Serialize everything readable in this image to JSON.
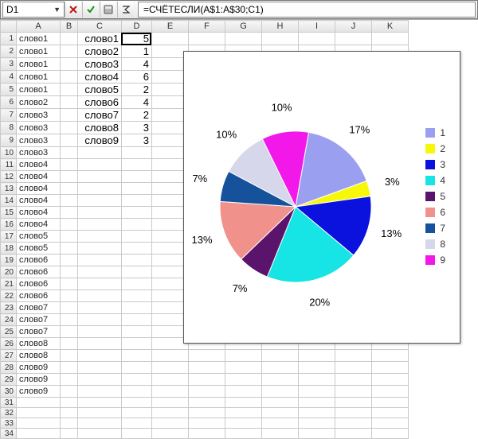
{
  "formula_bar": {
    "cell_ref": "D1",
    "formula": "=СЧЁТЕСЛИ(A$1:A$30;C1)"
  },
  "columns": [
    "A",
    "B",
    "C",
    "D",
    "E",
    "F",
    "G",
    "H",
    "I",
    "J",
    "K"
  ],
  "rows": [
    "1",
    "2",
    "3",
    "4",
    "5",
    "6",
    "7",
    "8",
    "9",
    "10",
    "11",
    "12",
    "13",
    "14",
    "15",
    "16",
    "17",
    "18",
    "19",
    "20",
    "21",
    "22",
    "23",
    "24",
    "25",
    "26",
    "27",
    "28",
    "29",
    "30",
    "31",
    "32",
    "33",
    "34"
  ],
  "colA": [
    "слово1",
    "слово1",
    "слово1",
    "слово1",
    "слово1",
    "слово2",
    "слово3",
    "слово3",
    "слово3",
    "слово3",
    "слово4",
    "слово4",
    "слово4",
    "слово4",
    "слово4",
    "слово4",
    "слово5",
    "слово5",
    "слово6",
    "слово6",
    "слово6",
    "слово6",
    "слово7",
    "слово7",
    "слово7",
    "слово8",
    "слово8",
    "слово9",
    "слово9",
    "слово9"
  ],
  "colC": [
    "слово1",
    "слово2",
    "слово3",
    "слово4",
    "слово5",
    "слово6",
    "слово7",
    "слово8",
    "слово9"
  ],
  "colD": [
    "5",
    "1",
    "4",
    "6",
    "2",
    "4",
    "2",
    "3",
    "3"
  ],
  "chart_data": {
    "type": "pie",
    "series_labels": [
      "1",
      "2",
      "3",
      "4",
      "5",
      "6",
      "7",
      "8",
      "9"
    ],
    "values": [
      5,
      1,
      4,
      6,
      2,
      4,
      2,
      3,
      3
    ],
    "percent_labels": [
      "17%",
      "3%",
      "13%",
      "20%",
      "7%",
      "13%",
      "7%",
      "10%",
      "10%"
    ],
    "colors": [
      "#9b9ff0",
      "#f7f70a",
      "#0b12de",
      "#17e4e4",
      "#5b146b",
      "#f0918c",
      "#16529c",
      "#d7d7ec",
      "#f218ea"
    ]
  }
}
